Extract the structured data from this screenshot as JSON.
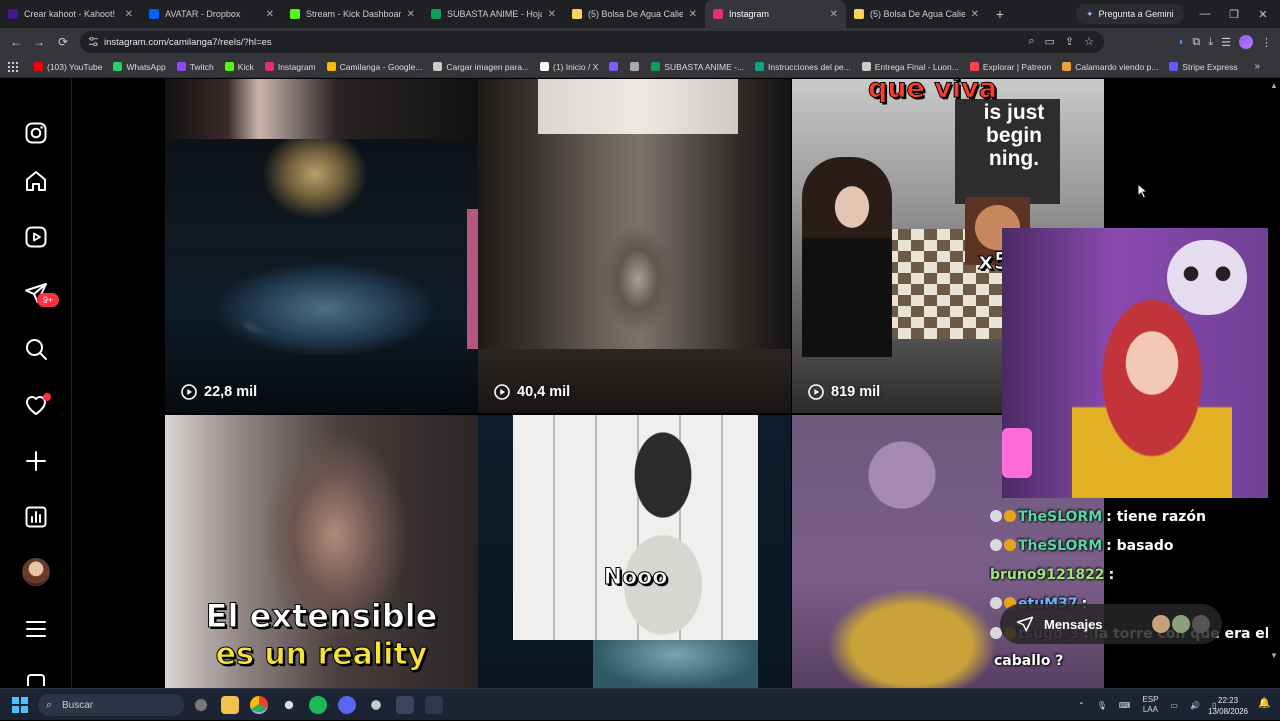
{
  "browser": {
    "tabs": [
      {
        "title": "Crear kahoot - Kahoot!",
        "color": "#46178f",
        "active": false
      },
      {
        "title": "AVATAR - Dropbox",
        "color": "#0061ff",
        "active": false
      },
      {
        "title": "Stream - Kick Dashboard",
        "color": "#53fc18",
        "active": false
      },
      {
        "title": "SUBASTA ANIME - Hojas de",
        "color": "#0f9d58",
        "active": false
      },
      {
        "title": "(5) Bolsa De Agua Caliente",
        "color": "#f4d35e",
        "active": false
      },
      {
        "title": "Instagram",
        "color": "#e1306c",
        "active": true
      },
      {
        "title": "(5) Bolsa De Agua Caliente",
        "color": "#f4d35e",
        "active": false
      }
    ],
    "gemini_label": "Pregunta a Gemini",
    "url": "instagram.com/camilanga7/reels/?hl=es",
    "bookmarks": [
      {
        "label": "(103) YouTube",
        "color": "#ff0000"
      },
      {
        "label": "WhatsApp",
        "color": "#25d366"
      },
      {
        "label": "Twitch",
        "color": "#9146ff"
      },
      {
        "label": "Kick",
        "color": "#53fc18"
      },
      {
        "label": "Instagram",
        "color": "#e1306c"
      },
      {
        "label": "Camilanga - Google...",
        "color": "#fbbc04"
      },
      {
        "label": "Cargar imagen para...",
        "color": "#cccccc"
      },
      {
        "label": "(1) Inicio / X",
        "color": "#ffffff"
      },
      {
        "label": "",
        "color": "#7b5cff"
      },
      {
        "label": "",
        "color": "#aaaaaa"
      },
      {
        "label": "SUBASTA ANIME -...",
        "color": "#0f9d58"
      },
      {
        "label": "Instrucciones del pe...",
        "color": "#10a37f"
      },
      {
        "label": "Entrega Final - Luon...",
        "color": "#cccccc"
      },
      {
        "label": "Explorar | Patreon",
        "color": "#ff424d"
      },
      {
        "label": "Calamardo viendo p...",
        "color": "#e8a33d"
      },
      {
        "label": "Stripe Express",
        "color": "#635bff"
      }
    ]
  },
  "instagram": {
    "notification_count": "9+",
    "reels": [
      {
        "views": "22,8 mil"
      },
      {
        "views": "40,4 mil"
      },
      {
        "views": "819 mil"
      }
    ],
    "overlay_texts": {
      "reel3_top": "que viva",
      "reel3_sign": "is just begin ning.",
      "reel3_x5": "x5",
      "reel4_line1": "El extensible",
      "reel4_line2": "es un reality",
      "reel5": "Nooo"
    },
    "messages_label": "Mensajes"
  },
  "stream_chat": [
    {
      "user": "TheSLORM",
      "text": ": tiene razón",
      "cls": "u1"
    },
    {
      "user": "TheSLORM",
      "text": ": basado",
      "cls": "u1"
    },
    {
      "user": "bruno9121822",
      "text": ":",
      "cls": "u2"
    },
    {
      "user": "etuM37",
      "text": ":",
      "cls": "u3"
    },
    {
      "user": "tsugo_3",
      "text": ": la torre con que era el",
      "cls": "u4"
    },
    {
      "user": "",
      "text": "caballo ?",
      "cls": "u4"
    }
  ],
  "taskbar": {
    "search_placeholder": "Buscar",
    "lang_top": "ESP",
    "lang_bottom": "LAA",
    "time": "22:23",
    "date": "13/08/2026"
  }
}
